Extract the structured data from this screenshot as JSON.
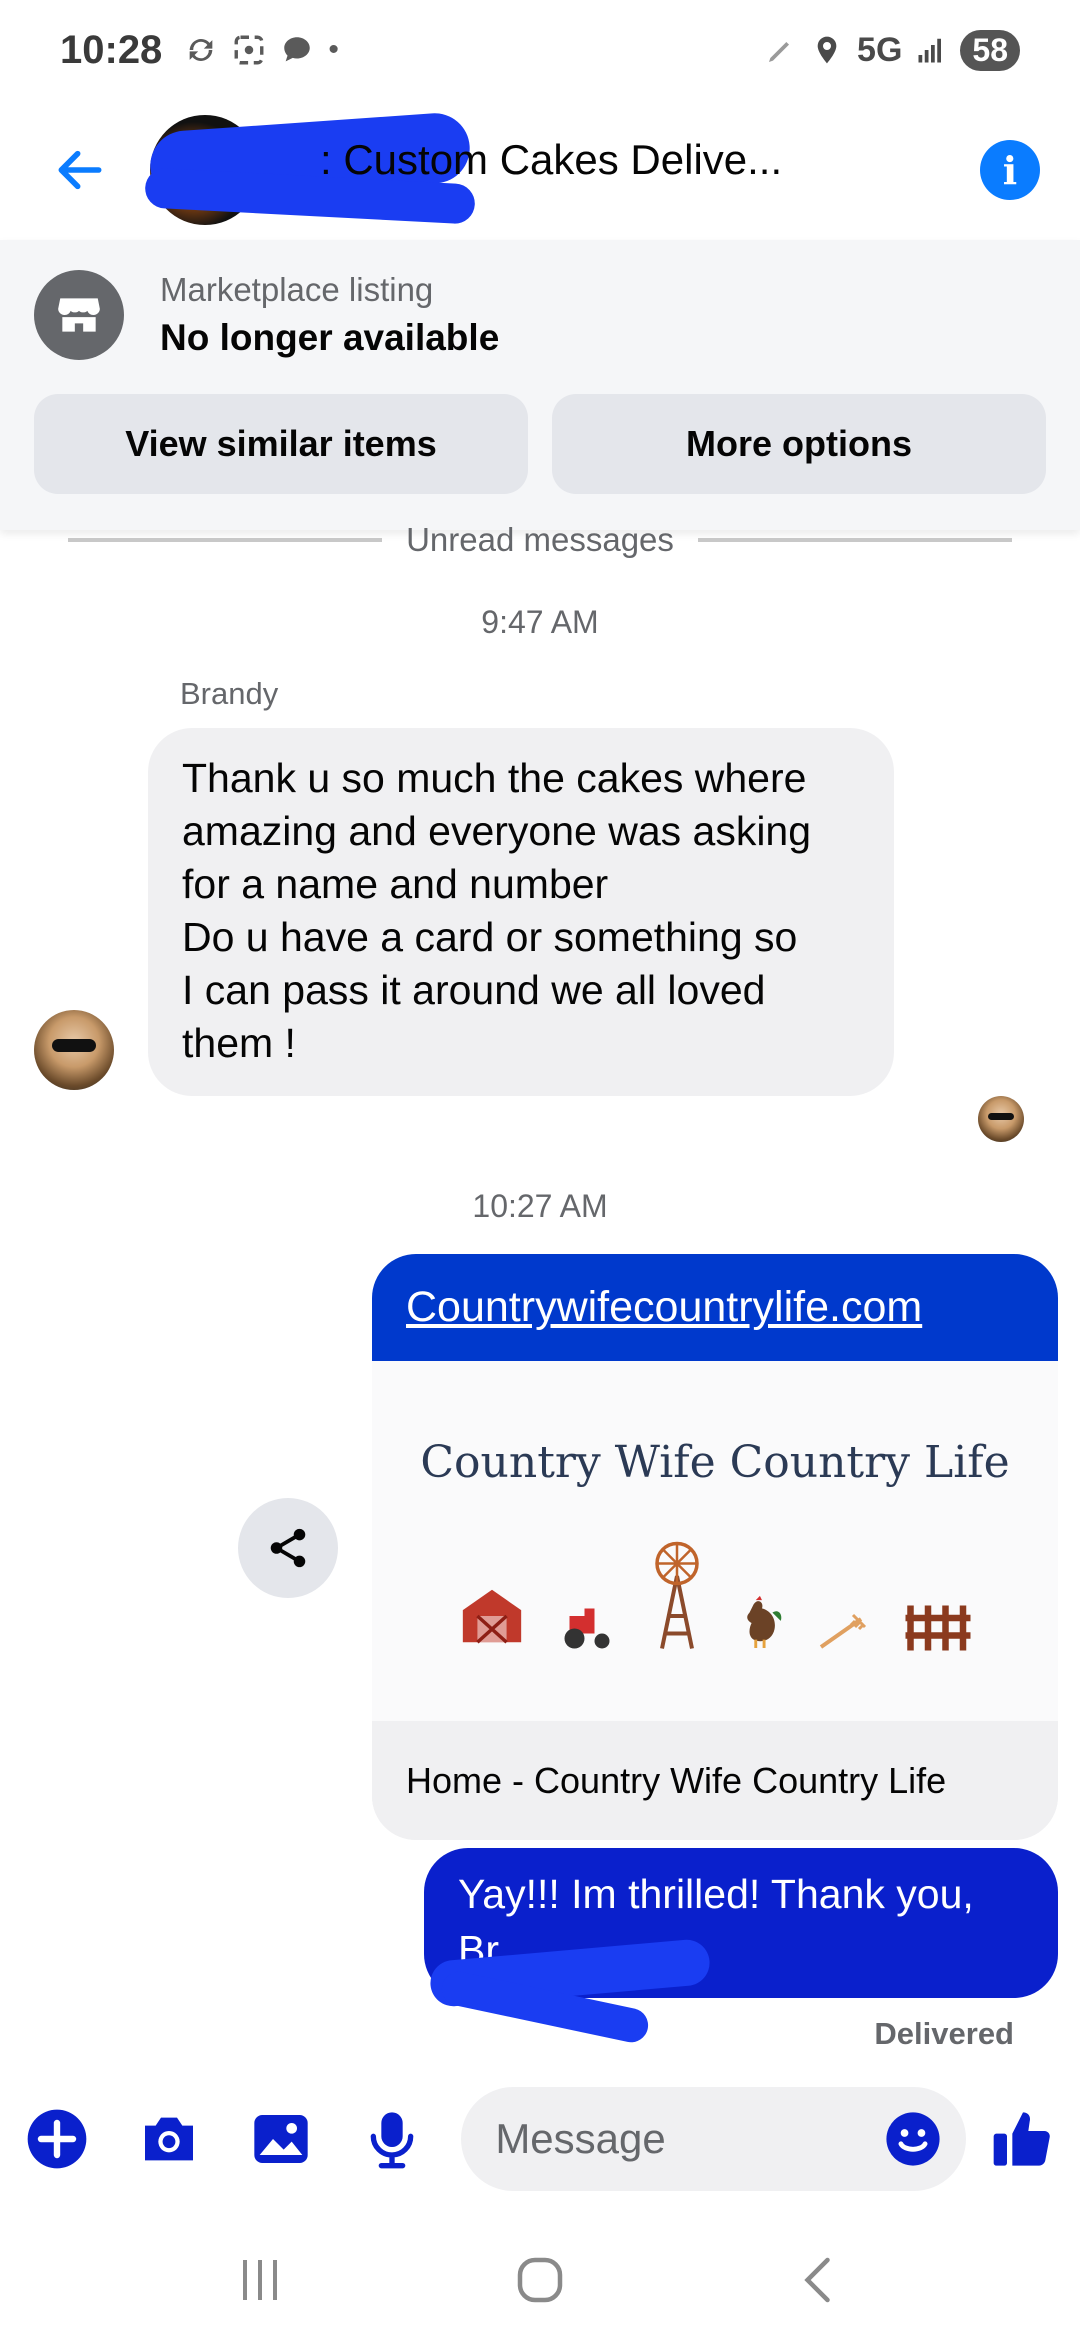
{
  "status_bar": {
    "time": "10:28",
    "network": "5G",
    "battery": "58"
  },
  "header": {
    "title": ": Custom Cakes Delive...",
    "accent_color": "#0a7cff"
  },
  "marketplace": {
    "label": "Marketplace listing",
    "status": "No longer available",
    "buttons": [
      "View similar items",
      "More options"
    ]
  },
  "divider": {
    "text": "Unread messages"
  },
  "conversation": {
    "timestamps": [
      "9:47 AM",
      "10:27 AM"
    ],
    "incoming": {
      "sender": "Brandy",
      "lines": [
        "Thank u so much the cakes where",
        "amazing and everyone was asking",
        "for a name and number",
        "Do u have a card or something so",
        "I can pass it around we all loved",
        "them !"
      ]
    },
    "link_card": {
      "url": "Countrywifecountrylife.com",
      "preview_title": "Country Wife Country Life",
      "footer": "Home - Country Wife Country Life"
    },
    "outgoing": {
      "text": "Yay!!! Im thrilled!  Thank you, Br"
    },
    "delivered": "Delivered"
  },
  "composer": {
    "placeholder": "Message"
  },
  "colors": {
    "outgoing_bubble": "#0a20cc",
    "link_header": "#0039cc",
    "icon_blue": "#0a20cc"
  }
}
